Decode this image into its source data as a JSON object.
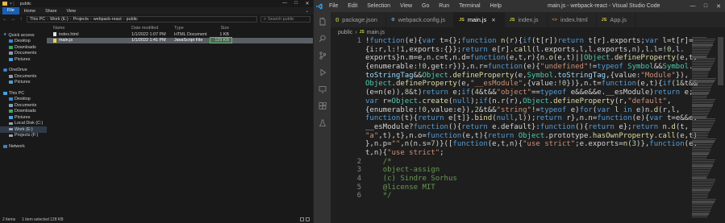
{
  "explorer": {
    "window_title": "public",
    "ribbon": [
      "File",
      "Home",
      "Share",
      "View"
    ],
    "address": [
      "This PC",
      "Work (E:)",
      "Projects",
      "webpack-react",
      "public"
    ],
    "search_placeholder": "Search public",
    "nav": [
      {
        "label": "Quick access",
        "icon": "star-icon",
        "indent": false
      },
      {
        "label": "Desktop",
        "icon": "desktop-icon",
        "indent": true
      },
      {
        "label": "Downloads",
        "icon": "download-icon",
        "indent": true
      },
      {
        "label": "Documents",
        "icon": "documents-icon",
        "indent": true
      },
      {
        "label": "Pictures",
        "icon": "pictures-icon",
        "indent": true
      },
      {
        "label": "OneDrive",
        "icon": "cloud-icon",
        "indent": false
      },
      {
        "label": "Documents",
        "icon": "documents-icon",
        "indent": true
      },
      {
        "label": "Pictures",
        "icon": "pictures-icon",
        "indent": true
      },
      {
        "label": "This PC",
        "icon": "pc-icon",
        "indent": false
      },
      {
        "label": "Desktop",
        "icon": "desktop-icon",
        "indent": true
      },
      {
        "label": "Documents",
        "icon": "documents-icon",
        "indent": true
      },
      {
        "label": "Downloads",
        "icon": "download-icon",
        "indent": true
      },
      {
        "label": "Pictures",
        "icon": "pictures-icon",
        "indent": true
      },
      {
        "label": "Local Disk (C:)",
        "icon": "drive-icon",
        "indent": true
      },
      {
        "label": "Work (E:)",
        "icon": "drive-icon",
        "indent": true
      },
      {
        "label": "Projects (F:)",
        "icon": "drive-icon",
        "indent": true
      },
      {
        "label": "Network",
        "icon": "network-icon",
        "indent": false
      }
    ],
    "columns": {
      "name": "Name",
      "date": "Date modified",
      "type": "Type",
      "size": "Size"
    },
    "files": [
      {
        "name": "index.html",
        "date": "1/1/2022 1:07 PM",
        "type": "HTML Document",
        "size": "1 KB",
        "icon": "html"
      },
      {
        "name": "main.js",
        "date": "1/1/2022 1:41 PM",
        "type": "JavaScript File",
        "size": "129 KB",
        "icon": "js"
      }
    ],
    "status": {
      "count": "2 items",
      "selected": "1 item selected  128 KB"
    }
  },
  "vscode": {
    "menu": [
      "File",
      "Edit",
      "Selection",
      "View",
      "Go",
      "Run",
      "Terminal",
      "Help"
    ],
    "window_title": "main.js - webpack-react - Visual Studio Code",
    "tabs": [
      {
        "label": "package.json",
        "icon": "{}",
        "kind": "json",
        "active": false
      },
      {
        "label": "webpack.config.js",
        "icon": "⚙",
        "kind": "cfg",
        "active": false
      },
      {
        "label": "main.js",
        "icon": "JS",
        "kind": "js",
        "active": true
      },
      {
        "label": "index.js",
        "icon": "JS",
        "kind": "js",
        "active": false
      },
      {
        "label": "index.html",
        "icon": "<>",
        "kind": "html",
        "active": false
      },
      {
        "label": "App.js",
        "icon": "JS",
        "kind": "js",
        "active": false
      }
    ],
    "breadcrumb": [
      "public",
      "main.js"
    ],
    "code": [
      {
        "gutter": "1",
        "html": "!<span class='k'>function</span>(e){<span class='k'>var</span> t={};<span class='k'>function</span> <span class='f'>n</span>(r){<span class='k'>if</span>(t[r])<span class='k'>return</span> t[r].exports;<span class='k'>var</span> l=t[r]="
      },
      {
        "gutter": "",
        "html": "{i:r,l:!<span class='n'>1</span>,exports:{}};<span class='k'>return</span> e[r].<span class='f'>call</span>(l.exports,l,l.exports,n),l.l=!<span class='n'>0</span>,l."
      },
      {
        "gutter": "",
        "html": "exports}n.m=e,n.c=t,n.d=<span class='k'>function</span>(e,t,r){n.<span class='f'>o</span>(e,t)||<span class='t'>Object</span>.<span class='f'>defineProperty</span>(e,t,"
      },
      {
        "gutter": "",
        "html": "{enumerable:!<span class='n'>0</span>,get:r})},n.r=<span class='k'>function</span>(e){<span class='s'>\"undefined\"</span>!=<span class='k'>typeof</span> <span class='t'>Symbol</span>&&<span class='t'>Symbol</span>."
      },
      {
        "gutter": "",
        "html": "<span class='v'>toStringTag</span>&&<span class='t'>Object</span>.<span class='f'>defineProperty</span>(e,<span class='t'>Symbol</span>.<span class='v'>toStringTag</span>,{value:<span class='s'>\"Module\"</span>}),"
      },
      {
        "gutter": "",
        "html": "<span class='t'>Object</span>.<span class='f'>defineProperty</span>(e,<span class='s'>\"__esModule\"</span>,{value:!<span class='n'>0</span>})},n.t=<span class='k'>function</span>(e,t){<span class='k'>if</span>(<span class='n'>1</span>&t&&"
      },
      {
        "gutter": "",
        "html": "(e=<span class='f'>n</span>(e)),<span class='n'>8</span>&t)<span class='k'>return</span> e;<span class='k'>if</span>(<span class='n'>4</span>&t&&<span class='s'>\"object\"</span>==<span class='k'>typeof</span> e&&e&&e.__esModule)<span class='k'>return</span> e;"
      },
      {
        "gutter": "",
        "html": "<span class='k'>var</span> r=<span class='t'>Object</span>.<span class='f'>create</span>(<span class='k'>null</span>);<span class='k'>if</span>(n.<span class='f'>r</span>(r),<span class='t'>Object</span>.<span class='f'>defineProperty</span>(r,<span class='s'>\"default\"</span>,"
      },
      {
        "gutter": "",
        "html": "{enumerable:!<span class='n'>0</span>,value:e}),<span class='n'>2</span>&t&&<span class='s'>\"string\"</span>!=<span class='k'>typeof</span> e)<span class='k'>for</span>(<span class='k'>var</span> l <span class='k'>in</span> e)n.<span class='f'>d</span>(r,l,"
      },
      {
        "gutter": "",
        "html": "<span class='k'>function</span>(t){<span class='k'>return</span> e[t]}.<span class='f'>bind</span>(<span class='k'>null</span>,l));<span class='k'>return</span> r},n.n=<span class='k'>function</span>(e){<span class='k'>var</span> t=e&&e."
      },
      {
        "gutter": "",
        "html": "__esModule?<span class='k'>function</span>(){<span class='k'>return</span> e.default}:<span class='k'>function</span>(){<span class='k'>return</span> e};<span class='k'>return</span> n.<span class='f'>d</span>(t,"
      },
      {
        "gutter": "",
        "html": "<span class='s'>\"a\"</span>,t),t},n.o=<span class='k'>function</span>(e,t){<span class='k'>return</span> <span class='t'>Object</span>.prototype.<span class='f'>hasOwnProperty</span>.<span class='f'>call</span>(e,t)"
      },
      {
        "gutter": "",
        "html": "},n.p=<span class='s'>\"\"</span>,<span class='f'>n</span>(n.s=<span class='n'>7</span>)}([<span class='k'>function</span>(e,t,n){<span class='s'>\"use strict\"</span>;e.exports=<span class='f'>n</span>(<span class='n'>3</span>)},<span class='k'>function</span>(e,"
      },
      {
        "gutter": "",
        "html": "t,n){<span class='s'>\"use strict\"</span>;"
      },
      {
        "gutter": "2",
        "html": "<span class='c'>/*</span>"
      },
      {
        "gutter": "3",
        "html": "<span class='c'>object-assign</span>"
      },
      {
        "gutter": "4",
        "html": "<span class='c'>(c) Sindre Sorhus</span>"
      },
      {
        "gutter": "5",
        "html": "<span class='c'>@license MIT</span>"
      },
      {
        "gutter": "6",
        "html": "<span class='c'>*/</span>"
      }
    ]
  }
}
